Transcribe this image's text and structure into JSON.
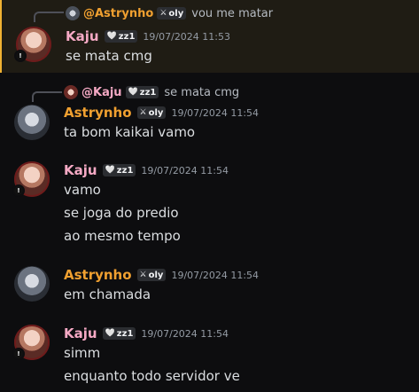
{
  "colors": {
    "kaju_name": "#f5a9c4",
    "astrynho_name": "#f0a030",
    "highlight_border": "#f0b132",
    "background": "#0d0d0f"
  },
  "messages": [
    {
      "reply": {
        "author": "@Astrynho",
        "tag_icon": "sword-icon",
        "tag": "oly",
        "text": "vou me matar"
      },
      "author": "Kaju",
      "tag_icon": "heart-icon",
      "tag": "zz1",
      "time": "19/07/2024 11:53",
      "lines": [
        "se mata cmg"
      ]
    },
    {
      "reply": {
        "author": "@Kaju",
        "tag_icon": "heart-icon",
        "tag": "zz1",
        "text": "se mata cmg"
      },
      "author": "Astrynho",
      "tag_icon": "sword-icon",
      "tag": "oly",
      "time": "19/07/2024 11:54",
      "lines": [
        "ta bom kaikai vamo"
      ]
    },
    {
      "author": "Kaju",
      "tag_icon": "heart-icon",
      "tag": "zz1",
      "time": "19/07/2024 11:54",
      "lines": [
        "vamo",
        "se joga do predio",
        "ao mesmo tempo"
      ]
    },
    {
      "author": "Astrynho",
      "tag_icon": "sword-icon",
      "tag": "oly",
      "time": "19/07/2024 11:54",
      "lines": [
        "em chamada"
      ]
    },
    {
      "author": "Kaju",
      "tag_icon": "heart-icon",
      "tag": "zz1",
      "time": "19/07/2024 11:54",
      "lines": [
        "simm",
        "enquanto todo servidor ve"
      ]
    }
  ]
}
